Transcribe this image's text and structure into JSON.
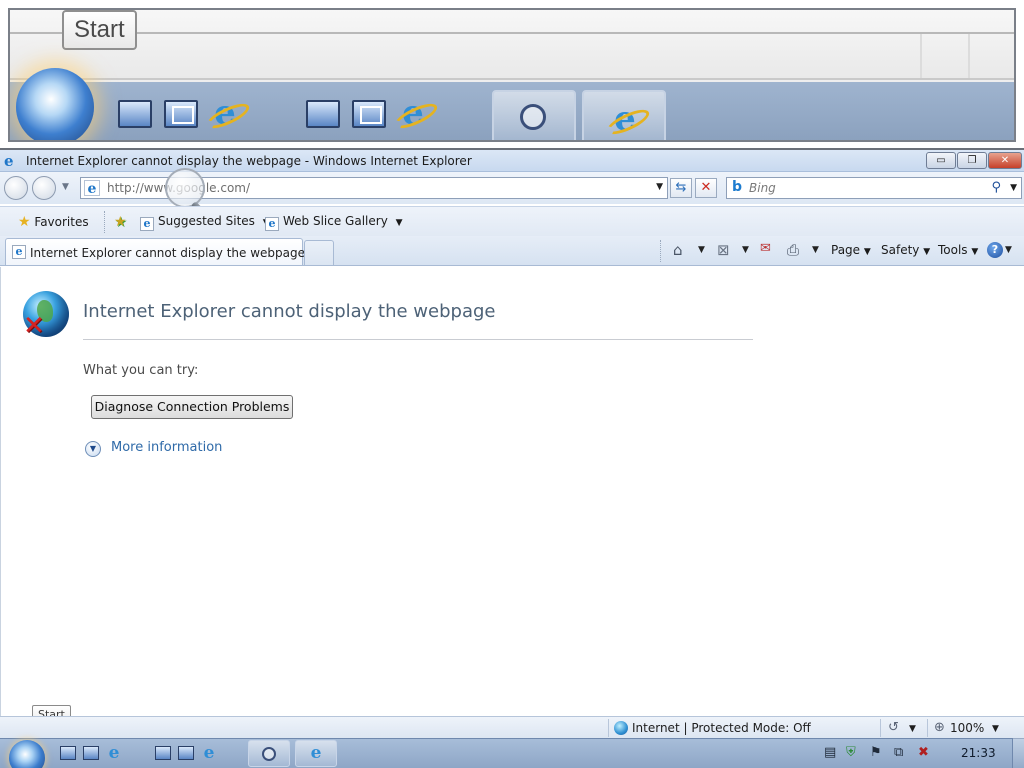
{
  "zoom_view": {
    "start_tooltip": "Start"
  },
  "window": {
    "title": "Internet Explorer cannot display the webpage - Windows Internet Explorer",
    "controls": {
      "minimize": "▭",
      "restore": "❐",
      "close": "✕"
    }
  },
  "address_bar": {
    "url": "http://www.google.com/"
  },
  "search_box": {
    "placeholder": "Bing"
  },
  "favorites_bar": {
    "favorites_label": "Favorites",
    "suggested_sites": "Suggested Sites",
    "web_slice_gallery": "Web Slice Gallery"
  },
  "tab": {
    "label": "Internet Explorer cannot display the webpage"
  },
  "command_bar": {
    "page": "Page",
    "safety": "Safety",
    "tools": "Tools"
  },
  "content": {
    "headline": "Internet Explorer cannot display the webpage",
    "what_to_try": "What you can try:",
    "diagnose_button": "Diagnose Connection Problems",
    "more_information": "More information"
  },
  "start_tooltip": "Start",
  "status_bar": {
    "zone": "Internet | Protected Mode: Off",
    "zoom": "100%"
  },
  "taskbar": {
    "clock": "21:33"
  },
  "colors": {
    "headline": "#4d6277",
    "link": "#2f6aa8",
    "taskbar": "#8ea6c6",
    "close_button": "#c6402a"
  },
  "icons": {
    "window": "ie-icon",
    "error": "globe-error-icon",
    "magnifier": "magnifier-lens-icon"
  }
}
